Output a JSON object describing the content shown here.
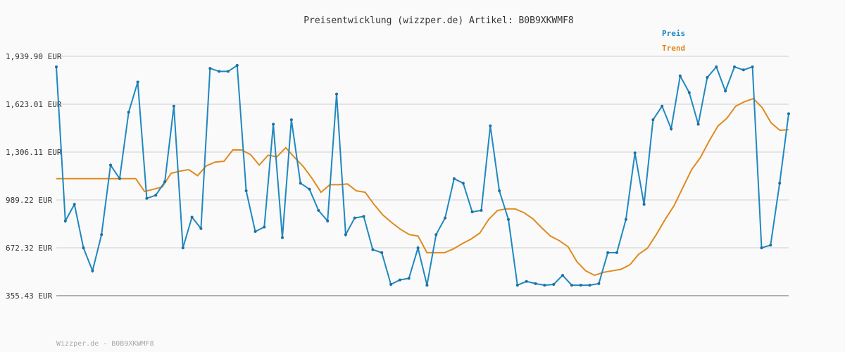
{
  "chart_data": {
    "type": "line",
    "title": "Preisentwicklung (wizzper.de) Artikel: B0B9XKWMF8",
    "y_tick_labels": [
      "1,939.90 EUR",
      "1,623.01 EUR",
      "1,306.11 EUR",
      "989.22 EUR",
      "672.32 EUR",
      "355.43 EUR"
    ],
    "ylim": [
      355.43,
      1939.9
    ],
    "grid": true,
    "legend_position": "top-right",
    "series": [
      {
        "name": "Preis",
        "color": "#1f88c0",
        "values": [
          1870,
          850,
          960,
          672,
          520,
          760,
          1220,
          1130,
          1570,
          1770,
          1000,
          1020,
          1110,
          1610,
          672,
          875,
          800,
          1860,
          1840,
          1840,
          1880,
          1050,
          780,
          810,
          1490,
          740,
          1520,
          1100,
          1060,
          920,
          850,
          1690,
          760,
          870,
          880,
          660,
          640,
          430,
          460,
          470,
          672,
          425,
          760,
          870,
          1130,
          1100,
          910,
          920,
          1480,
          1050,
          860,
          425,
          450,
          435,
          425,
          430,
          490,
          425,
          425,
          425,
          435,
          640,
          640,
          860,
          1300,
          960,
          1520,
          1610,
          1460,
          1810,
          1700,
          1490,
          1800,
          1870,
          1710,
          1870,
          1850,
          1870,
          672,
          690,
          1100,
          1560
        ]
      },
      {
        "name": "Trend",
        "color": "#e08a1e",
        "values": [
          1130,
          1130,
          1130,
          1130,
          1130,
          1130,
          1130,
          1130,
          1130,
          1130,
          1045,
          1060,
          1075,
          1165,
          1180,
          1190,
          1150,
          1215,
          1240,
          1245,
          1320,
          1320,
          1290,
          1220,
          1285,
          1275,
          1335,
          1270,
          1210,
          1130,
          1040,
          1090,
          1090,
          1095,
          1050,
          1040,
          960,
          890,
          840,
          795,
          760,
          750,
          640,
          640,
          640,
          665,
          700,
          730,
          770,
          860,
          920,
          930,
          930,
          905,
          865,
          805,
          750,
          720,
          680,
          580,
          520,
          490,
          510,
          520,
          530,
          560,
          630,
          670,
          760,
          860,
          950,
          1070,
          1190,
          1270,
          1380,
          1480,
          1530,
          1610,
          1640,
          1660,
          1600,
          1500,
          1450,
          1455
        ]
      }
    ]
  },
  "footer": {
    "text": "Wizzper.de - B0B9XKWMF8"
  }
}
